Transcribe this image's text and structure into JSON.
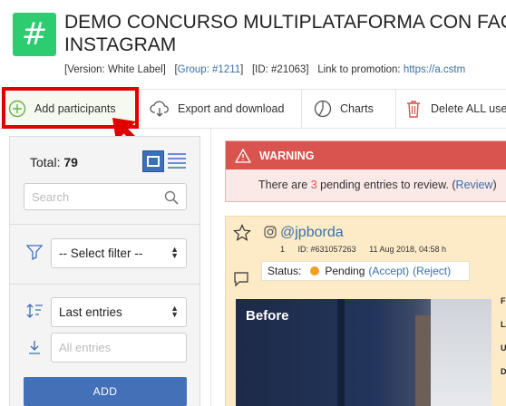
{
  "header": {
    "title_line1": "DEMO CONCURSO MULTIPLATAFORMA CON FACI",
    "title_line2": "INSTAGRAM",
    "version": "[Version: White Label]",
    "group_prefix": "[",
    "group_link": "Group: #1211",
    "group_suffix": "]",
    "id": "[ID: #21063]",
    "link_label": "Link to promotion:",
    "link_value": "https://a.cstm"
  },
  "toolbar": {
    "add": "Add participants",
    "export": "Export and download",
    "charts": "Charts",
    "delete": "Delete ALL use"
  },
  "sidebar": {
    "total_label": "Total:",
    "total_value": "79",
    "search_placeholder": "Search",
    "filter": "-- Select filter --",
    "order": "Last entries",
    "entries_placeholder": "All entries",
    "add_button": "ADD"
  },
  "warning": {
    "title": "WARNING",
    "text_before": "There are",
    "count": "3",
    "text_after": "pending entries to review.",
    "review_open": "(",
    "review_link": "Review",
    "review_close": ")"
  },
  "entry": {
    "handle": "@jpborda",
    "index": "1",
    "id": "ID: #631057263",
    "date": "11 Aug 2018, 04:58 h",
    "status_label": "Status:",
    "status_value": "Pending",
    "accept": "(Accept)",
    "reject": "(Reject)",
    "image_caption": "Before"
  },
  "side_labels": [
    "Fi",
    "La",
    "U",
    "Di"
  ],
  "colors": {
    "accent_green": "#2ecc71",
    "highlight_red": "#e00000",
    "warning_red": "#d9534f",
    "link_blue": "#3a6ea5",
    "button_blue": "#4470b8",
    "card_bg": "#fdebc8",
    "pending_orange": "#f0a020"
  }
}
